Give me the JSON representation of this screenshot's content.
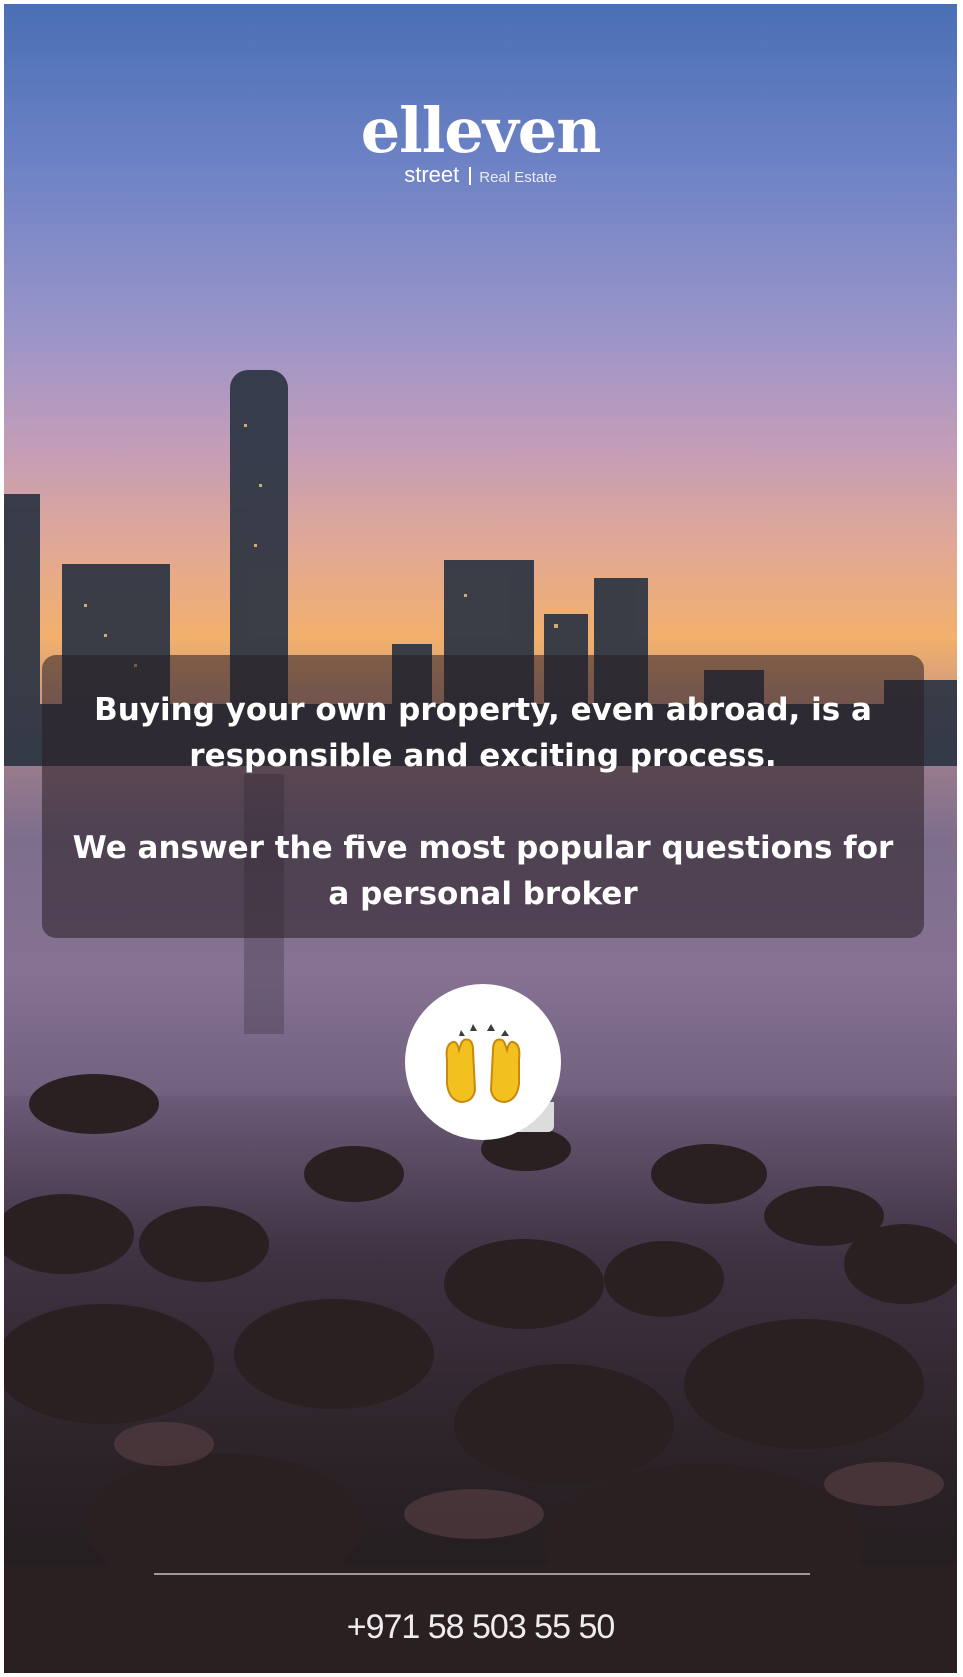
{
  "logo": {
    "main": "elleven",
    "sub": "street",
    "tag": "Real Estate"
  },
  "card": {
    "line1": "Buying your own property, even abroad, is a responsible and exciting process.",
    "line2": "We answer the five most popular questions for a personal broker"
  },
  "emoji": {
    "icon": "raising-hands-icon"
  },
  "footer": {
    "phone": "+971 58 503 55 50"
  },
  "colors": {
    "text": "#ffffff",
    "card_bg": "rgba(40,30,35,0.55)",
    "emoji_bubble": "#ffffff"
  }
}
